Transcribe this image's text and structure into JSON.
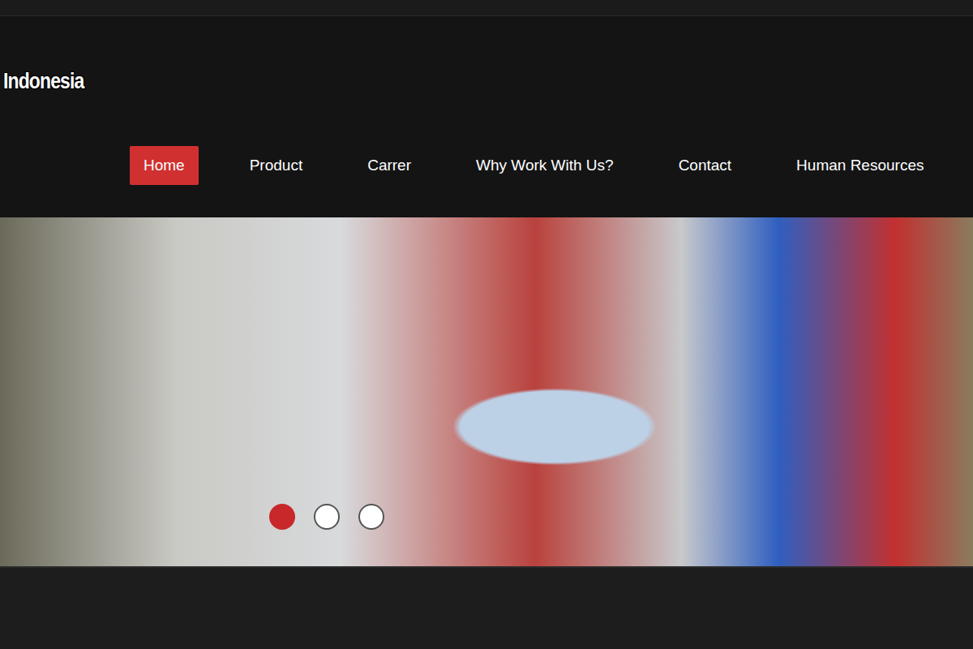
{
  "logo": {
    "text": "Indonesia"
  },
  "nav": [
    {
      "label": "Home",
      "selected": true
    },
    {
      "label": "Product",
      "selected": false
    },
    {
      "label": "Carrer",
      "selected": false
    },
    {
      "label": "Why Work With Us?",
      "selected": false
    },
    {
      "label": "Contact",
      "selected": false
    },
    {
      "label": "Human Resources",
      "selected": false
    }
  ],
  "slider": {
    "dots": [
      {
        "selected": true
      },
      {
        "selected": false
      },
      {
        "selected": false
      }
    ]
  }
}
